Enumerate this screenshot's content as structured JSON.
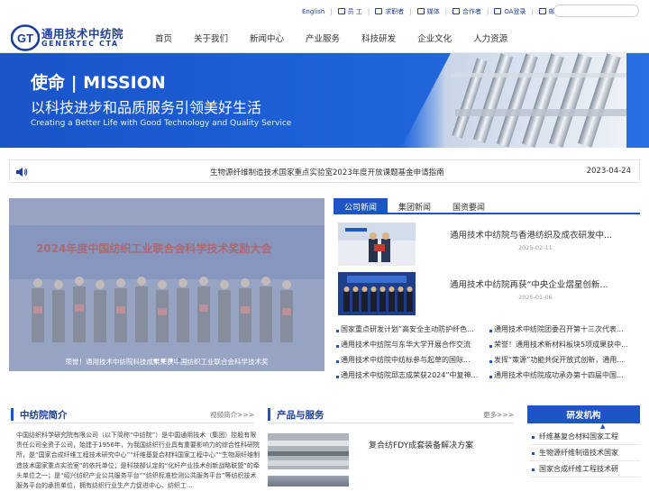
{
  "top": {
    "links": [
      {
        "label": "English",
        "icon": ""
      },
      {
        "label": "员 工",
        "icon": "user-icon"
      },
      {
        "label": "求职者",
        "icon": "job-seeker-icon"
      },
      {
        "label": "媒体",
        "icon": "media-icon"
      },
      {
        "label": "合作者",
        "icon": "partner-icon"
      },
      {
        "label": "OA登录",
        "icon": "oa-icon"
      },
      {
        "label": "邮箱登录",
        "icon": "mail-icon"
      }
    ],
    "search_placeholder": ""
  },
  "logo": {
    "cn": "通用技术中纺院",
    "en": "GENERTEC CTA",
    "mark": "GT"
  },
  "menu": [
    "首页",
    "关于我们",
    "新闻中心",
    "产业服务",
    "科技研发",
    "企业文化",
    "人力资源"
  ],
  "banner": {
    "t1": "使命 | MISSION",
    "t2": "以科技进步和品质服务引领美好生活",
    "t3": "Creating a Better Life with Good Technology and Quality Service"
  },
  "notice": {
    "text": "生物源纤维制造技术国家重点实验室2023年度开放课题基金申请指南",
    "date": "2023-04-24"
  },
  "slide": {
    "title": "2024年度中国纺织工业联合会科学技术奖励大会",
    "caption": "荣誉！通用技术中纺院科技成果荣获中国纺织工业联合会科学技术奖",
    "dots": 4,
    "active_dot": 3
  },
  "news_tabs": [
    "公司新闻",
    "集团新闻",
    "国资要闻"
  ],
  "featured": [
    {
      "title": "通用技术中纺院与香港纺织及成衣研发中...",
      "date": "2025-02-11"
    },
    {
      "title": "通用技术中纺院再获“中央企业熠星创新...",
      "date": "2025-01-06"
    }
  ],
  "news_list": [
    [
      "国家重点研发计划“高安全主动防护纤色...",
      "通用技术中纺院团委召开第十三次代表..."
    ],
    [
      "通用技术中纺院与东华大学开展合作交流",
      "荣誉！通用技术新材料板块5项成果获中..."
    ],
    [
      "通用技术中纺院中纺标参与起草的国际...",
      "发挥“策源”功能共促开放式创新，通用..."
    ],
    [
      "通用技术中纺院邱志成荣获2024“中复神...",
      "通用技术中纺院成功承办第十四届中国..."
    ]
  ],
  "intro": {
    "title": "中纺院简介",
    "more": "视频简介>>>",
    "text": "中国纺织科学研究院有限公司（以下简称“中纺院”）是中国通用技术（集团）控股有限责任公司全资子公司，始建于1956年，为我国纺织行业具有重要影响力的综合性科研院所，是“国家合成纤维工程技术研究中心”“纤维基复合材料国家工程中心”“生物源纤维制造技术国家重点实验室”的依托单位；是科技部认定的“化纤产业技术创新战略联盟”的牵头单位之一；是“绍兴纺织产业公共服务平台”“纺织标准检测公共服务平台”等纺织技术服务平台的承担单位，拥有纺织行业生产力促进中心、纺织工..."
  },
  "products": {
    "title": "产品与服务",
    "more": "更多>>>",
    "items": [
      "复合纺FDY成套装备解决方案"
    ]
  },
  "research": {
    "title": "研发机构",
    "items": [
      "纤维基复合材料国家工程",
      "生物源纤维制造技术国家",
      "国家合成纤维工程技术研"
    ]
  }
}
